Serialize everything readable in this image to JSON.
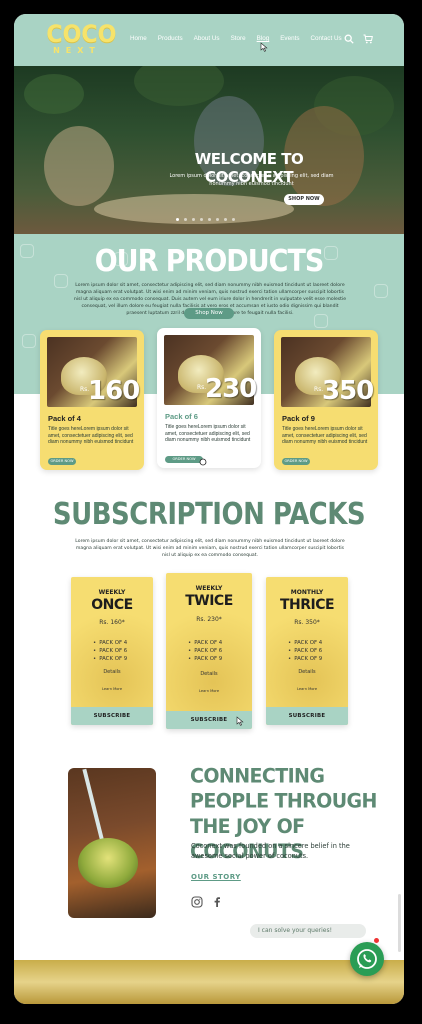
{
  "nav": {
    "logo_main": "COCO",
    "logo_sub": "NEXT",
    "items": [
      "Home",
      "Products",
      "About Us",
      "Store",
      "Blog",
      "Events",
      "Contact Us"
    ],
    "active_item": "Blog"
  },
  "hero": {
    "title": "WELCOME TO COCONEXT",
    "subtitle": "Lorem ipsum dolor sit amet, consectetur adipiscing elit, sed diam nonummy nibh euismod tincidunt",
    "button": "SHOP NOW"
  },
  "products": {
    "title": "OUR PRODUCTS",
    "text": "Lorem ipsum dolor sit amet, consectetur adipiscing elit, sed diam nonummy nibh euismod tincidunt ut laoreet dolore magna aliquam erat volutpat. Ut wisi enim ad minim veniam, quis nostrud exerci tation ullamcorper suscipit lobortis nisl ut aliquip ex ea commodo consequat. Duis autem vel eum iriure dolor in hendrerit in vulputate velit esse molestie consequat, vel illum dolore eu feugiat nulla facilisis at vero eros et accumsan et iusto odio dignissim qui blandit praesent luptatum zzril delenit augue duis dolore te feugait nulla facilisi.",
    "shop_button": "Shop Now",
    "cards": [
      {
        "price": "160",
        "rs": "Rs.",
        "name": "Pack of 4",
        "desc": "Title goes hereLorem ipsum dolor sit amet, consectetuer adipiscing elit, sed diam nonummy nibh euismod tincidunt",
        "button": "ORDER NOW"
      },
      {
        "price": "230",
        "rs": "Rs.",
        "name": "Pack of 6",
        "desc": "Title goes hereLorem ipsum dolor sit amet, consectetuer adipiscing elit, sed diam nonummy nibh euismod tincidunt",
        "button": "ORDER NOW"
      },
      {
        "price": "350",
        "rs": "Rs.",
        "name": "Pack of 9",
        "desc": "Title goes hereLorem ipsum dolor sit amet, consectetuer adipiscing elit, sed diam nonummy nibh euismod tincidunt",
        "button": "ORDER NOW"
      }
    ]
  },
  "subscription": {
    "title": "SUBSCRIPTION PACKS",
    "text": "Lorem ipsum dolor sit amet, consectetur adipiscing elit, sed diam nonummy nibh euismod tincidunt ut laoreet dolore magna aliquam erat volutpat. Ut wisi enim ad minim veniam, quis nostrud exerci tation ullamcorper suscipit lobortis nisl ut aliquip ex ea commodo consequat.",
    "packs": [
      {
        "freq": "WEEKLY",
        "name": "ONCE",
        "price": "Rs. 160*",
        "items": [
          "PACK OF 4",
          "PACK OF 6",
          "PACK OF 9"
        ],
        "details": "Details",
        "more": "Learn More",
        "button": "SUBSCRIBE"
      },
      {
        "freq": "WEEKLY",
        "name": "TWICE",
        "price": "Rs. 230*",
        "items": [
          "PACK OF 4",
          "PACK OF 6",
          "PACK OF 9"
        ],
        "details": "Details",
        "more": "Learn More",
        "button": "SUBSCRIBE"
      },
      {
        "freq": "MONTHLY",
        "name": "THRICE",
        "price": "Rs. 350*",
        "items": [
          "PACK OF 4",
          "PACK OF 6",
          "PACK OF 9"
        ],
        "details": "Details",
        "more": "Learn More",
        "button": "SUBSCRIBE"
      }
    ]
  },
  "connecting": {
    "title_line1": "CONNECTING",
    "title_line2": "PEOPLE THROUGH",
    "title_line3": "THE JOY OF COCONUTS",
    "text": "Coconext was founded on a sincere belief in the awesome social power of coconuts.",
    "link": "OUR STORY"
  },
  "chat": {
    "bubble": "I can solve your queries!"
  },
  "colors": {
    "mint": "#a9d3c4",
    "yellow": "#f6dd71",
    "green_text": "#5e8a74",
    "button_green": "#5e9b86",
    "whatsapp": "#2a9d55"
  }
}
